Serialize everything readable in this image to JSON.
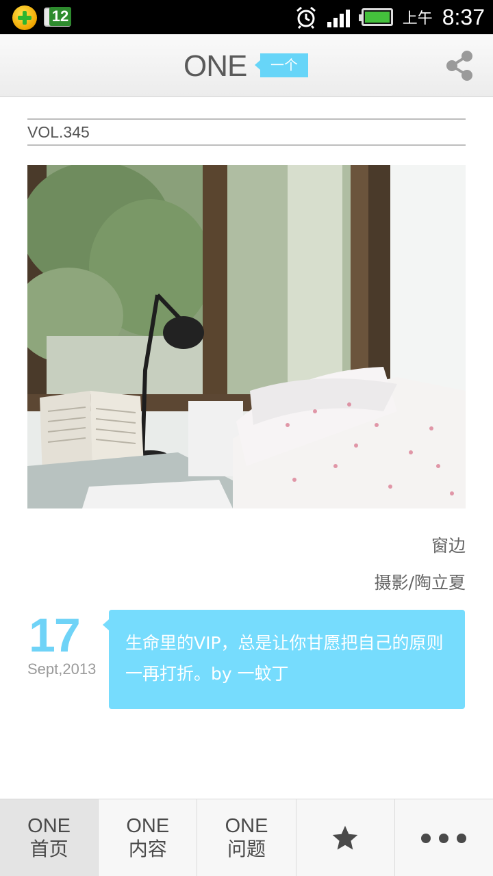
{
  "status_bar": {
    "calendar_day": "12",
    "ampm": "上午",
    "time": "8:37",
    "icons": [
      "app-plus-icon",
      "calendar-icon",
      "alarm-icon",
      "signal-icon",
      "battery-icon"
    ]
  },
  "header": {
    "logo_text": "ONE",
    "logo_tag": "一个",
    "share_icon": "share-icon"
  },
  "issue": {
    "volume": "VOL.345"
  },
  "photo": {
    "title": "窗边",
    "credit": "摄影/陶立夏"
  },
  "date": {
    "day": "17",
    "month_year": "Sept,2013"
  },
  "quote": {
    "text": "生命里的VIP，总是让你甘愿把自己的原则一再打折。by 一蚊丁"
  },
  "nav": {
    "items": [
      {
        "top": "ONE",
        "bottom": "首页",
        "active": true
      },
      {
        "top": "ONE",
        "bottom": "内容"
      },
      {
        "top": "ONE",
        "bottom": "问题"
      },
      {
        "icon": "star-icon"
      },
      {
        "icon": "more-icon"
      }
    ]
  },
  "colors": {
    "accent": "#6fd3f7",
    "quote_bg": "#76dcfd"
  }
}
